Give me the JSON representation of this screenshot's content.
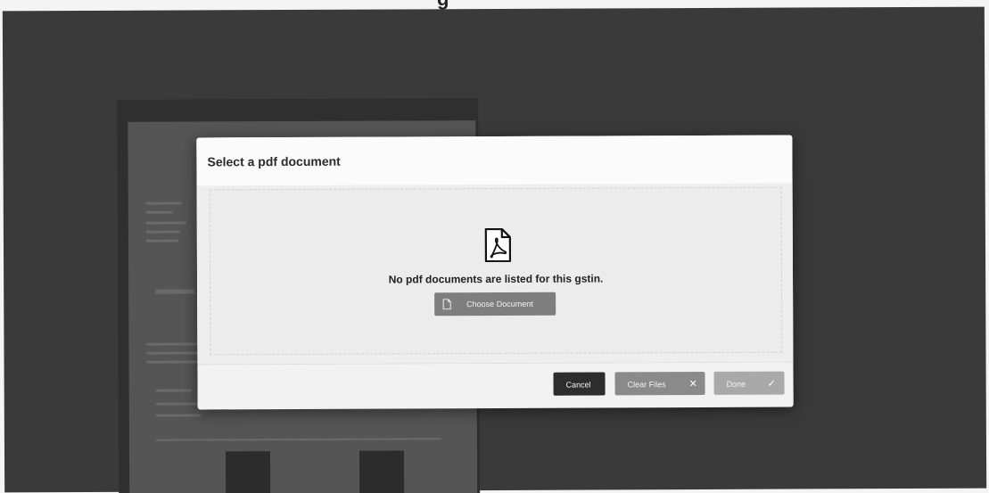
{
  "page": {
    "top_heading_fragment": "g"
  },
  "dialog": {
    "title": "Select a pdf document",
    "empty_message": "No pdf documents are listed for this gstin.",
    "choose_button_label": "Choose Document",
    "cancel_label": "Cancel",
    "clear_label": "Clear Files",
    "done_label": "Done",
    "icons": {
      "pdf": "pdf-file-icon",
      "choose": "document-icon",
      "clear": "close-icon",
      "done": "check-icon"
    }
  },
  "colors": {
    "backdrop": "#3a3a3a",
    "cancel_button": "#2d2d2d",
    "clear_button": "#8a8a8a",
    "done_button": "#a9a9a9",
    "choose_button": "#7e7e7e"
  }
}
